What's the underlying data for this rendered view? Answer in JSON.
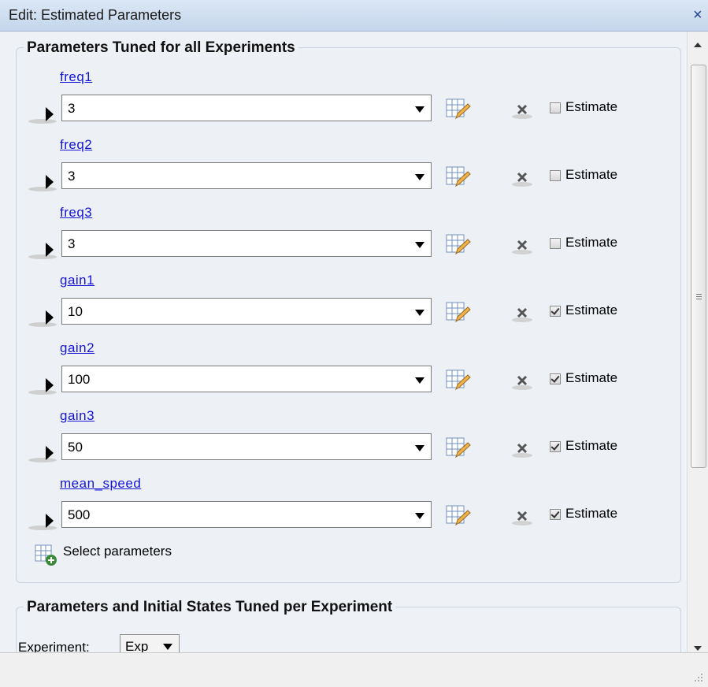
{
  "window": {
    "title": "Edit: Estimated Parameters",
    "close_glyph": "×"
  },
  "group_all": {
    "title": "Parameters Tuned for all Experiments",
    "params": [
      {
        "name": "freq1",
        "value": "3",
        "estimate_label": "Estimate",
        "estimate_checked": false
      },
      {
        "name": "freq2",
        "value": "3",
        "estimate_label": "Estimate",
        "estimate_checked": false
      },
      {
        "name": "freq3",
        "value": "3",
        "estimate_label": "Estimate",
        "estimate_checked": false
      },
      {
        "name": "gain1",
        "value": "10",
        "estimate_label": "Estimate",
        "estimate_checked": true
      },
      {
        "name": "gain2",
        "value": "100",
        "estimate_label": "Estimate",
        "estimate_checked": true
      },
      {
        "name": "gain3",
        "value": "50",
        "estimate_label": "Estimate",
        "estimate_checked": true
      },
      {
        "name": "mean_speed",
        "value": "500",
        "estimate_label": "Estimate",
        "estimate_checked": true
      }
    ],
    "select_label": "Select parameters"
  },
  "group_per_exp": {
    "title": "Parameters and Initial States Tuned per Experiment",
    "experiment_label": "Experiment:",
    "experiment_value": "Exp"
  },
  "icons": {
    "expand": "expand-arrow-icon",
    "edit": "table-edit-icon",
    "remove": "remove-x-icon",
    "add": "add-parameters-icon"
  },
  "colors": {
    "link": "#1515d8",
    "accent": "#3a8a3a"
  }
}
